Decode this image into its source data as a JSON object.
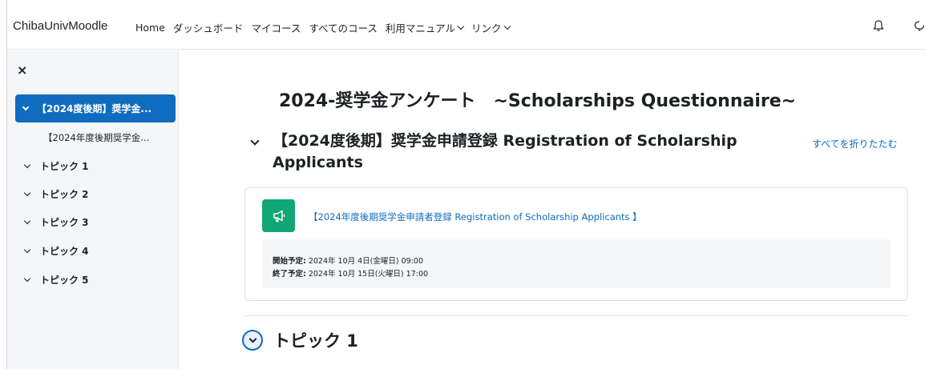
{
  "navbar": {
    "brand": "ChibaUnivMoodle",
    "items": [
      {
        "label": "Home",
        "dropdown": false
      },
      {
        "label": "ダッシュボード",
        "dropdown": false
      },
      {
        "label": "マイコース",
        "dropdown": false
      },
      {
        "label": "すべてのコース",
        "dropdown": false
      },
      {
        "label": "利用マニュアル",
        "dropdown": true
      },
      {
        "label": "リンク",
        "dropdown": true
      }
    ],
    "icons": [
      "bell-icon",
      "chat-icon"
    ]
  },
  "sidebar": {
    "close_icon": "×",
    "active_section": "【2024度後期】奨学金...",
    "sub_item": "【2024年度後期奨学金...",
    "topics": [
      "トピック 1",
      "トピック 2",
      "トピック 3",
      "トピック 4",
      "トピック 5"
    ]
  },
  "main": {
    "page_title": "2024-奨学金アンケート　~Scholarships Questionnaire~",
    "section_title": "【2024度後期】奨学金申請登録 Registration of Scholarship Applicants",
    "collapse_all": "すべてを折りたたむ",
    "activity": {
      "icon": "megaphone-icon",
      "link": "【2024年度後期奨学金申請者登録 Registration of Scholarship Applicants 】",
      "start_label": "開始予定:",
      "start_value": " 2024年 10月 4日(金曜日) 09:00",
      "end_label": "終了予定:",
      "end_value": " 2024年 10月 15日(火曜日) 17:00"
    },
    "next_topic": "トピック 1"
  },
  "colors": {
    "primary": "#0f6cbf",
    "activity_icon_bg": "#11a676",
    "sidebar_bg": "#f5f6f8"
  }
}
